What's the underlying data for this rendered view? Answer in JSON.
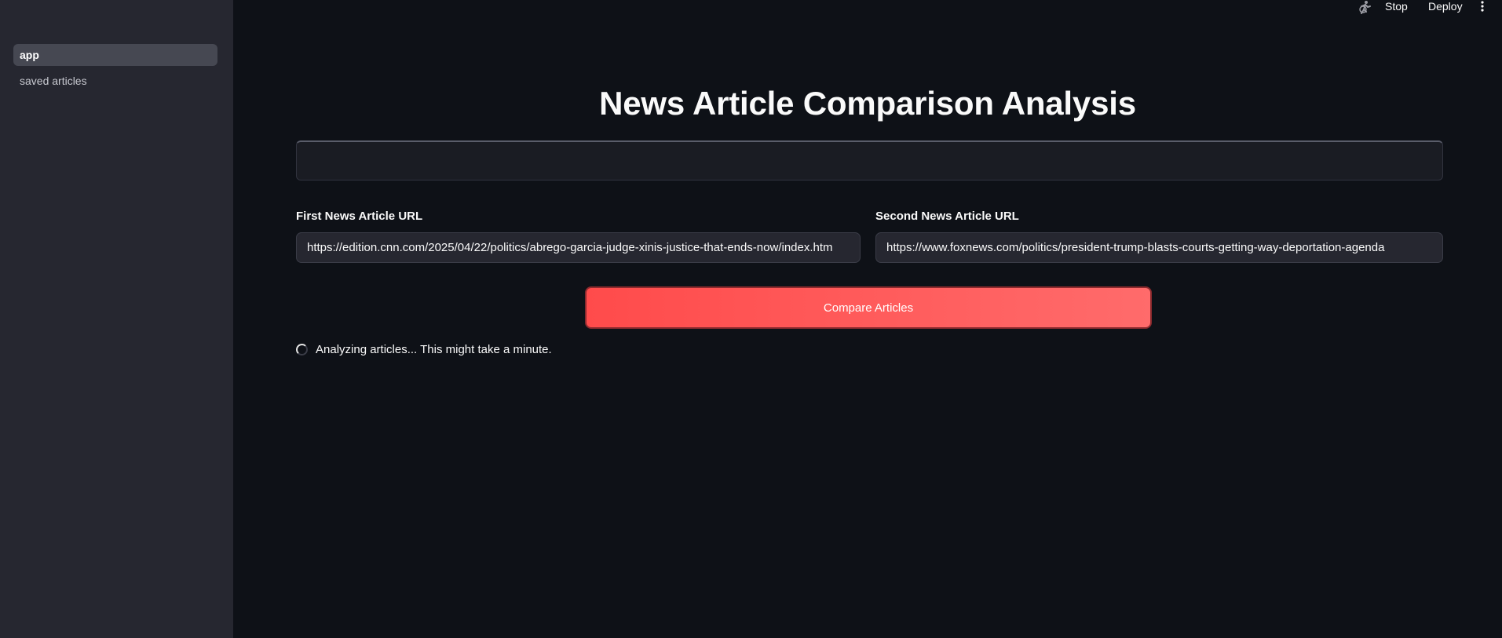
{
  "sidebar": {
    "items": [
      {
        "label": "app",
        "active": true
      },
      {
        "label": "saved articles",
        "active": false
      }
    ]
  },
  "toolbar": {
    "accessibility_icon": "running-man-icon",
    "stop_label": "Stop",
    "deploy_label": "Deploy",
    "menu_icon": "vertical-dots-icon"
  },
  "main": {
    "title": "News Article Comparison Analysis",
    "first_url": {
      "label": "First News Article URL",
      "value": "https://edition.cnn.com/2025/04/22/politics/abrego-garcia-judge-xinis-justice-that-ends-now/index.htm"
    },
    "second_url": {
      "label": "Second News Article URL",
      "value": "https://www.foxnews.com/politics/president-trump-blasts-courts-getting-way-deportation-agenda"
    },
    "compare_button": "Compare Articles",
    "status_text": "Analyzing articles... This might take a minute."
  },
  "colors": {
    "background": "#0e1117",
    "sidebar": "#262730",
    "primary": "#ff4b4b"
  }
}
